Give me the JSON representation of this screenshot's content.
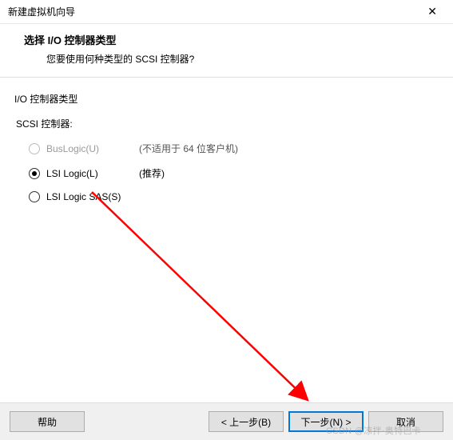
{
  "window": {
    "title": "新建虚拟机向导",
    "close_glyph": "✕"
  },
  "header": {
    "heading": "选择 I/O 控制器类型",
    "subheading": "您要使用何种类型的 SCSI 控制器?"
  },
  "group": {
    "label": "I/O 控制器类型",
    "sublabel": "SCSI 控制器:",
    "options": [
      {
        "label": "BusLogic(U)",
        "note": "(不适用于 64 位客户机)",
        "selected": false,
        "disabled": true
      },
      {
        "label": "LSI Logic(L)",
        "note": "(推荐)",
        "selected": true,
        "disabled": false
      },
      {
        "label": "LSI Logic SAS(S)",
        "note": "",
        "selected": false,
        "disabled": false
      }
    ]
  },
  "footer": {
    "help": "帮助",
    "back": "< 上一步(B)",
    "next": "下一步(N) >",
    "cancel": "取消"
  },
  "watermark": "CSDN @凉拌-奥特巴卡"
}
